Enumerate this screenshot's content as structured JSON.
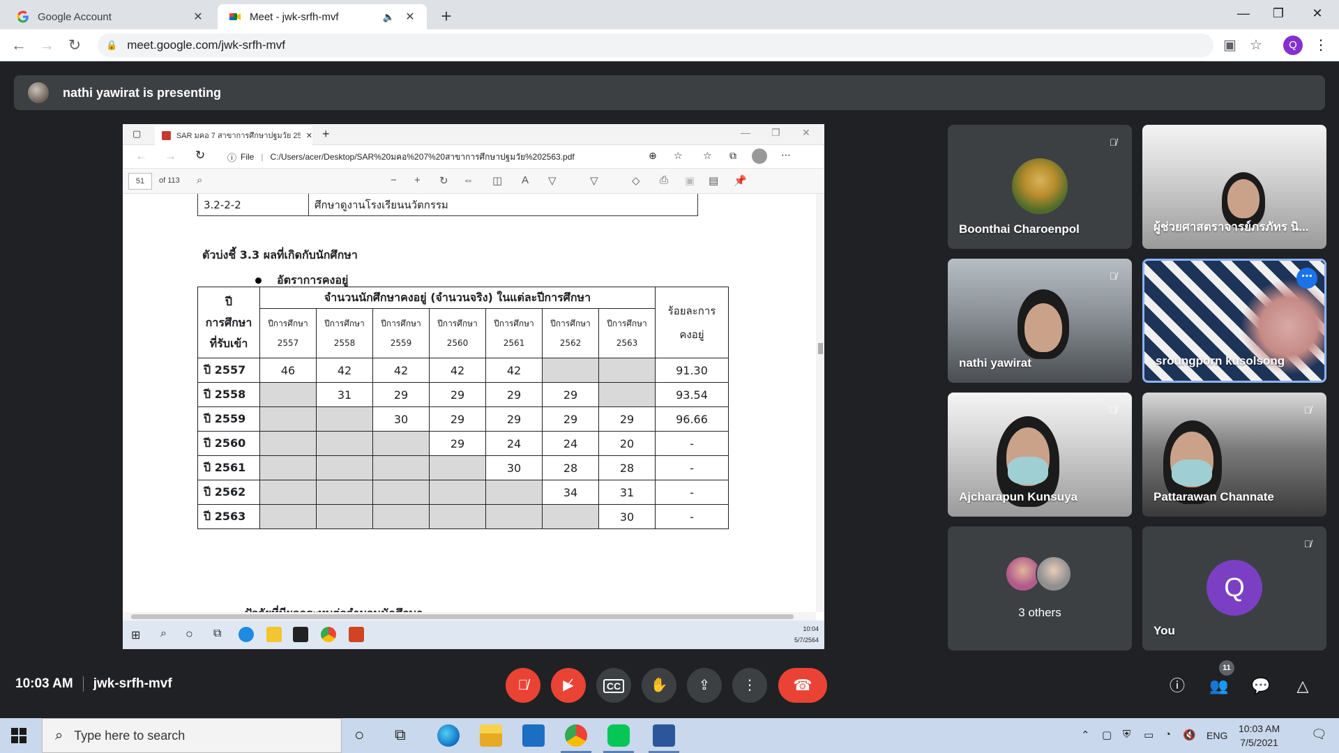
{
  "browser": {
    "tabs": [
      {
        "title": "Google Account",
        "active": false
      },
      {
        "title": "Meet - jwk-srfh-mvf",
        "active": true
      }
    ],
    "url": "meet.google.com/jwk-srfh-mvf",
    "profile_initial": "Q"
  },
  "meet": {
    "presenting_text": "nathi yawirat is presenting",
    "time": "10:03 AM",
    "meeting_code": "jwk-srfh-mvf",
    "people_count": "11",
    "participants": [
      {
        "name": "Boonthai Charoenpol",
        "muted": true,
        "video": false
      },
      {
        "name": "ผู้ช่วยศาสตราจารย์ภรภัทร นิ...",
        "muted": false,
        "video": true
      },
      {
        "name": "nathi yawirat",
        "muted": true,
        "video": true
      },
      {
        "name": "sroungporn kusolsong",
        "muted": false,
        "video": true,
        "speaking": true
      },
      {
        "name": "Ajcharapun Kunsuya",
        "muted": true,
        "video": true
      },
      {
        "name": "Pattarawan Channate",
        "muted": true,
        "video": true
      },
      {
        "name": "3 others",
        "muted": false,
        "video": false
      },
      {
        "name": "You",
        "muted": true,
        "video": false,
        "initial": "Q"
      }
    ]
  },
  "shared_screen": {
    "tab_title": "SAR มคอ 7 สาขาการศึกษาปฐมวัย 25",
    "file_label": "File",
    "file_path": "C:/Users/acer/Desktop/SAR%20มคอ%207%20สาขาการศึกษาปฐมวัย%202563.pdf",
    "page_number": "51",
    "page_total": "of 113",
    "top_row": {
      "code": "3.2-2-2",
      "text": "ศึกษาดูงานโรงเรียนนวัตกรรม"
    },
    "indicator_heading": "ตัวบ่งชี้ 3.3 ผลที่เกิดกับนักศึกษา",
    "bullet_text": "อัตราการคงอยู่",
    "table": {
      "year_header": [
        "ปี",
        "การศึกษา",
        "ที่รับเข้า"
      ],
      "group_header": "จำนวนนักศึกษาคงอยู่ (จำนวนจริง) ในแต่ละปีการศึกษา",
      "sub_header_label": "ปีการศึกษา",
      "sub_header_years": [
        "2557",
        "2558",
        "2559",
        "2560",
        "2561",
        "2562",
        "2563"
      ],
      "pct_header": [
        "ร้อยละการ",
        "คงอยู่"
      ],
      "rows": [
        {
          "year": "ปี 2557",
          "cells": [
            "46",
            "42",
            "42",
            "42",
            "42",
            "",
            ""
          ],
          "pct": "91.30"
        },
        {
          "year": "ปี 2558",
          "cells": [
            "",
            "31",
            "29",
            "29",
            "29",
            "29",
            ""
          ],
          "pct": "93.54"
        },
        {
          "year": "ปี 2559",
          "cells": [
            "",
            "",
            "30",
            "29",
            "29",
            "29",
            "29"
          ],
          "pct": "96.66"
        },
        {
          "year": "ปี 2560",
          "cells": [
            "",
            "",
            "",
            "29",
            "24",
            "24",
            "20"
          ],
          "pct": "-"
        },
        {
          "year": "ปี 2561",
          "cells": [
            "",
            "",
            "",
            "",
            "30",
            "28",
            "28"
          ],
          "pct": "-"
        },
        {
          "year": "ปี 2562",
          "cells": [
            "",
            "",
            "",
            "",
            "",
            "34",
            "31"
          ],
          "pct": "-"
        },
        {
          "year": "ปี 2563",
          "cells": [
            "",
            "",
            "",
            "",
            "",
            "",
            "30"
          ],
          "pct": "-"
        }
      ]
    },
    "factor_heading": "ปัจจัยที่มีผลกระทบต่อจำนวนนักศึกษา",
    "clock_time": "10:04",
    "clock_date": "5/7/2564"
  },
  "taskbar": {
    "search_placeholder": "Type here to search",
    "lang": "ENG",
    "time": "10:03 AM",
    "date": "7/5/2021"
  }
}
